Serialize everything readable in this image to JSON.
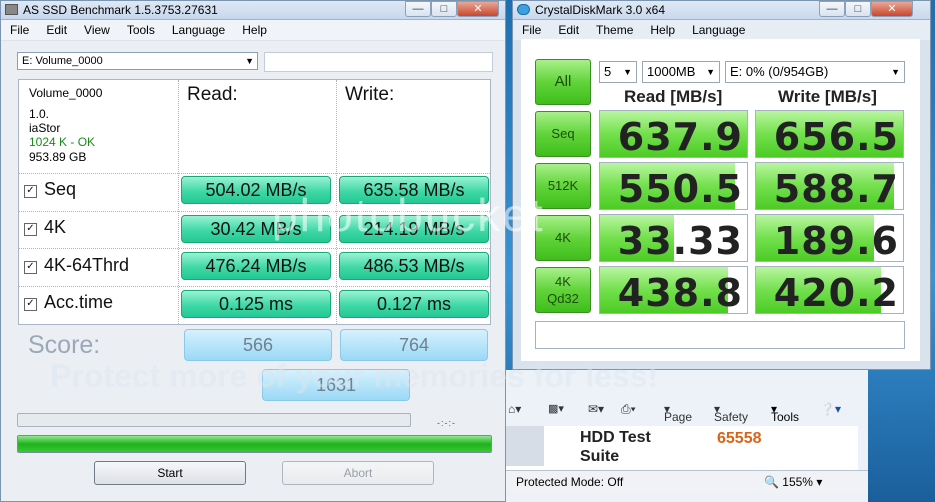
{
  "asssd": {
    "title": "AS SSD Benchmark 1.5.3753.27631",
    "menu": [
      "File",
      "Edit",
      "View",
      "Tools",
      "Language",
      "Help"
    ],
    "drive_selected": "E: Volume_0000",
    "info": {
      "name": "Volume_0000",
      "version": "1.0.",
      "driver": "iaStor",
      "alignment": "1024 K - OK",
      "size": "953.89 GB"
    },
    "read_header": "Read:",
    "write_header": "Write:",
    "rows": [
      {
        "label": "Seq",
        "read": "504.02 MB/s",
        "write": "635.58 MB/s"
      },
      {
        "label": "4K",
        "read": "30.42 MB/s",
        "write": "214.19 MB/s"
      },
      {
        "label": "4K-64Thrd",
        "read": "476.24 MB/s",
        "write": "486.53 MB/s"
      },
      {
        "label": "Acc.time",
        "read": "0.125 ms",
        "write": "0.127 ms"
      }
    ],
    "score_label": "Score:",
    "score_read": "566",
    "score_write": "764",
    "score_total": "1631",
    "progress_percent": 100,
    "start_button": "Start",
    "abort_button": "Abort",
    "ticks_text": "-:-:-"
  },
  "cdm": {
    "title": "CrystalDiskMark 3.0 x64",
    "menu": [
      "File",
      "Edit",
      "Theme",
      "Help",
      "Language"
    ],
    "all_button": "All",
    "runs": "5",
    "size": "1000MB",
    "drive": "E: 0% (0/954GB)",
    "read_header": "Read [MB/s]",
    "write_header": "Write [MB/s]",
    "tests": [
      {
        "label": "Seq",
        "read": "637.9",
        "write": "656.5"
      },
      {
        "label": "512K",
        "read": "550.5",
        "write": "588.7"
      },
      {
        "label": "4K",
        "read": "33.33",
        "write": "189.6"
      },
      {
        "label_line1": "4K",
        "label_line2": "Qd32",
        "read": "438.8",
        "write": "420.2"
      }
    ]
  },
  "ie": {
    "page_label": "Page",
    "safety_label": "Safety",
    "tools_label": "Tools",
    "content_title_line1": "HDD Test",
    "content_title_line2": "Suite",
    "content_score": "65558",
    "status_text": "Protected Mode: Off",
    "zoom": "155%"
  },
  "watermark": {
    "brand": "photobucket",
    "tagline": "Protect more of your memories for less!"
  }
}
